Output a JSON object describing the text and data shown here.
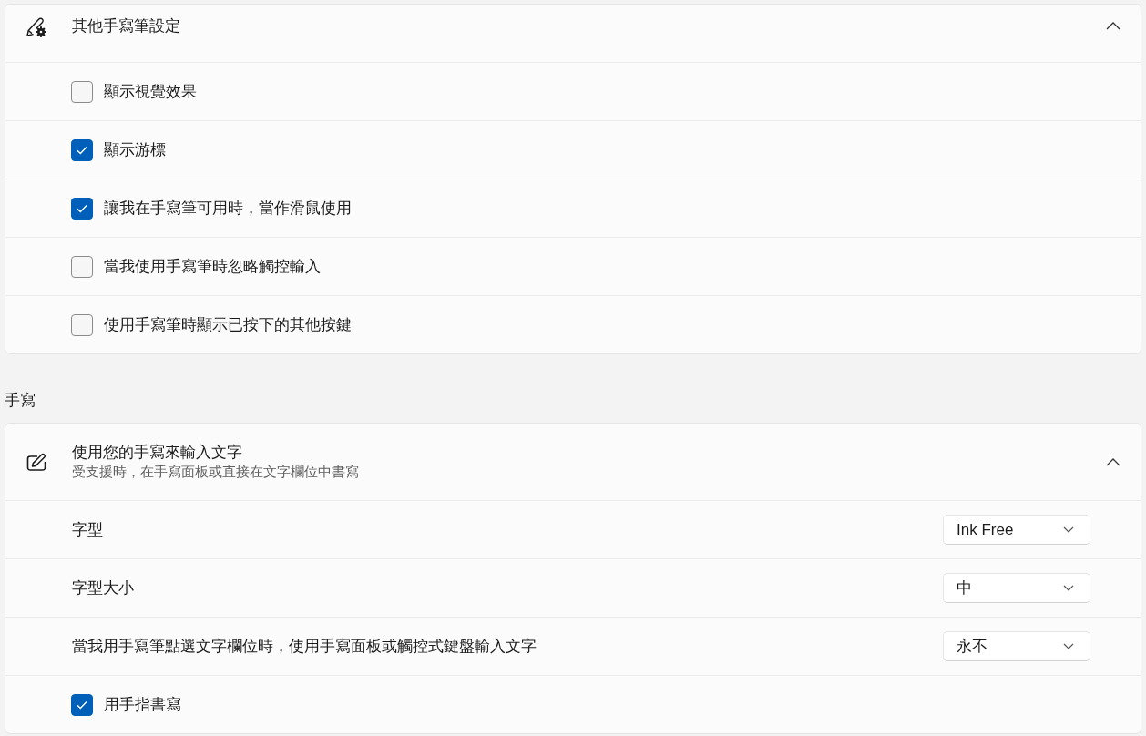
{
  "groups": [
    {
      "header": {
        "title": "其他手寫筆設定",
        "expanded": true
      },
      "rows": [
        {
          "kind": "checkbox",
          "label": "顯示視覺效果",
          "checked": false
        },
        {
          "kind": "checkbox",
          "label": "顯示游標",
          "checked": true
        },
        {
          "kind": "checkbox",
          "label": "讓我在手寫筆可用時，當作滑鼠使用",
          "checked": true
        },
        {
          "kind": "checkbox",
          "label": "當我使用手寫筆時忽略觸控輸入",
          "checked": false
        },
        {
          "kind": "checkbox",
          "label": "使用手寫筆時顯示已按下的其他按鍵",
          "checked": false
        }
      ]
    },
    {
      "section_title": "手寫",
      "header": {
        "title": "使用您的手寫來輸入文字",
        "subtitle": "受支援時，在手寫面板或直接在文字欄位中書寫",
        "expanded": true
      },
      "rows": [
        {
          "kind": "dropdown",
          "label": "字型",
          "value": "Ink Free"
        },
        {
          "kind": "dropdown",
          "label": "字型大小",
          "value": "中"
        },
        {
          "kind": "dropdown",
          "label": "當我用手寫筆點選文字欄位時，使用手寫面板或觸控式鍵盤輸入文字",
          "value": "永不"
        },
        {
          "kind": "checkbox",
          "label": "用手指書寫",
          "checked": true
        }
      ]
    }
  ]
}
